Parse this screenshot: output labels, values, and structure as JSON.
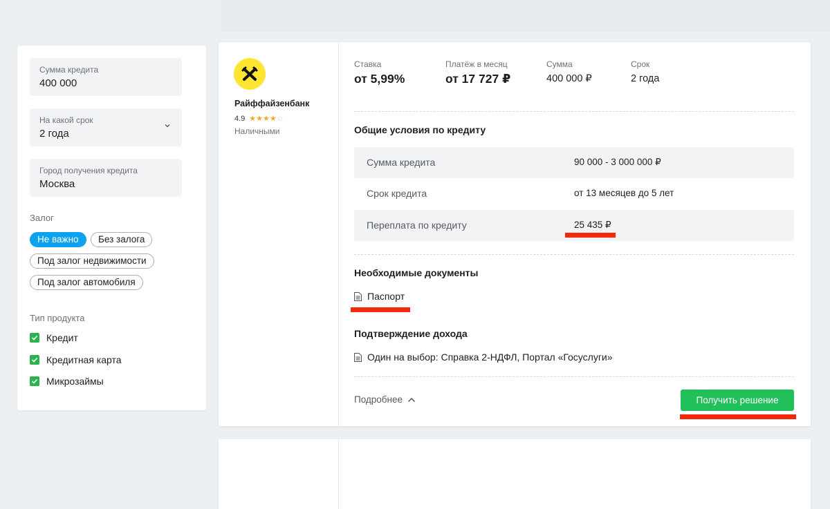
{
  "filters": {
    "loan_amount": {
      "label": "Сумма кредита",
      "value": "400 000"
    },
    "term": {
      "label": "На какой срок",
      "value": "2 года"
    },
    "city": {
      "label": "Город получения кредита",
      "value": "Москва"
    },
    "collateral": {
      "title": "Залог",
      "options": [
        "Не важно",
        "Без залога",
        "Под залог недвижимости",
        "Под залог автомобиля"
      ],
      "selected": "Не важно"
    },
    "product_type": {
      "title": "Тип продукта",
      "items": [
        {
          "label": "Кредит",
          "checked": true
        },
        {
          "label": "Кредитная карта",
          "checked": true
        },
        {
          "label": "Микрозаймы",
          "checked": true
        }
      ]
    }
  },
  "offer": {
    "bank_name": "Райффайзенбанк",
    "rating": "4.9",
    "rating_stars": 4,
    "loan_type": "Наличными",
    "summary": [
      {
        "label": "Ставка",
        "value": "от 5,99%"
      },
      {
        "label": "Платёж в месяц",
        "value": "от 17 727 ₽"
      },
      {
        "label": "Сумма",
        "value": "400 000 ₽"
      },
      {
        "label": "Срок",
        "value": "2 года"
      }
    ],
    "general_title": "Общие условия по кредиту",
    "conditions": [
      {
        "label": "Сумма кредита",
        "value": "90 000 - 3 000 000 ₽"
      },
      {
        "label": "Срок кредита",
        "value": "от 13 месяцев до 5 лет"
      },
      {
        "label": "Переплата по кредиту",
        "value": "25 435 ₽"
      }
    ],
    "documents_title": "Необходимые документы",
    "documents": [
      "Паспорт"
    ],
    "income_title": "Подтверждение дохода",
    "income": [
      "Один на выбор: Справка 2-НДФЛ, Портал «Госуслуги»"
    ],
    "more_label": "Подробнее",
    "cta_label": "Получить решение"
  },
  "colors": {
    "accent_blue": "#0da2f0",
    "cta_green": "#21c05a",
    "checkbox_green": "#2bb24c",
    "highlight_red": "#f5290a",
    "logo_yellow": "#fde531"
  }
}
